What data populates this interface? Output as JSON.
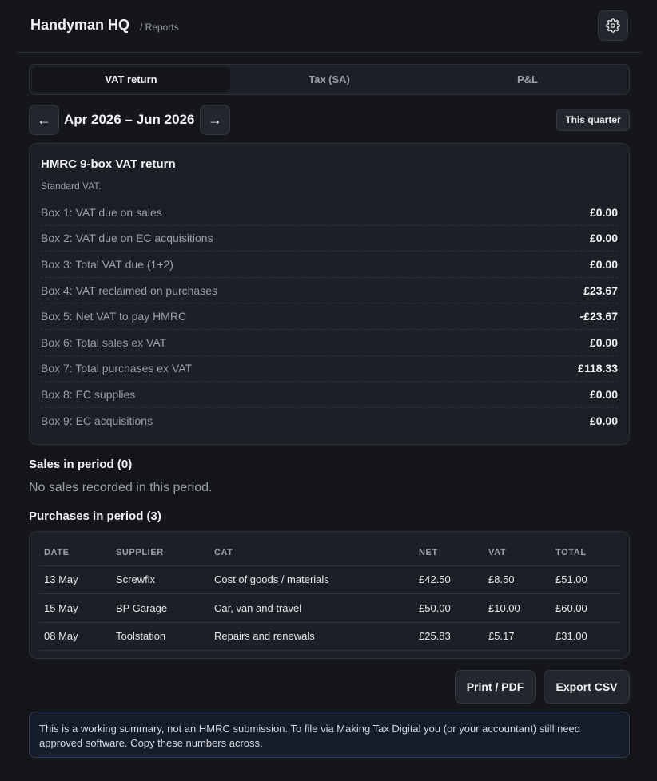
{
  "header": {
    "app_title": "Handyman HQ",
    "breadcrumb": "/ Reports"
  },
  "tabs": [
    {
      "label": "VAT return",
      "active": true
    },
    {
      "label": "Tax (SA)",
      "active": false
    },
    {
      "label": "P&L",
      "active": false
    }
  ],
  "period": {
    "prev_label": "←",
    "label": "Apr 2026 – Jun 2026",
    "next_label": "→",
    "quick_label": "This quarter"
  },
  "vat_return": {
    "title": "HMRC 9-box VAT return",
    "subtitle": "Standard VAT.",
    "boxes": [
      {
        "label": "Box 1: VAT due on sales",
        "value": "£0.00"
      },
      {
        "label": "Box 2: VAT due on EC acquisitions",
        "value": "£0.00"
      },
      {
        "label": "Box 3: Total VAT due (1+2)",
        "value": "£0.00"
      },
      {
        "label": "Box 4: VAT reclaimed on purchases",
        "value": "£23.67"
      },
      {
        "label": "Box 5: Net VAT to pay HMRC",
        "value": "-£23.67"
      },
      {
        "label": "Box 6: Total sales ex VAT",
        "value": "£0.00"
      },
      {
        "label": "Box 7: Total purchases ex VAT",
        "value": "£118.33"
      },
      {
        "label": "Box 8: EC supplies",
        "value": "£0.00"
      },
      {
        "label": "Box 9: EC acquisitions",
        "value": "£0.00"
      }
    ]
  },
  "sales": {
    "heading": "Sales in period (0)",
    "empty_text": "No sales recorded in this period."
  },
  "purchases": {
    "heading": "Purchases in period (3)",
    "columns": [
      "DATE",
      "SUPPLIER",
      "CAT",
      "NET",
      "VAT",
      "TOTAL"
    ],
    "rows": [
      [
        "13 May",
        "Screwfix",
        "Cost of goods / materials",
        "£42.50",
        "£8.50",
        "£51.00"
      ],
      [
        "15 May",
        "BP Garage",
        "Car, van and travel",
        "£50.00",
        "£10.00",
        "£60.00"
      ],
      [
        "08 May",
        "Toolstation",
        "Repairs and renewals",
        "£25.83",
        "£5.17",
        "£31.00"
      ]
    ]
  },
  "actions": {
    "print_label": "Print / PDF",
    "export_label": "Export CSV"
  },
  "notice": "This is a working summary, not an HMRC submission. To file via Making Tax Digital you (or your accountant) still need approved software. Copy these numbers across.",
  "icons": {
    "settings": "gear-icon",
    "prev": "arrow-left-icon",
    "next": "arrow-right-icon"
  }
}
